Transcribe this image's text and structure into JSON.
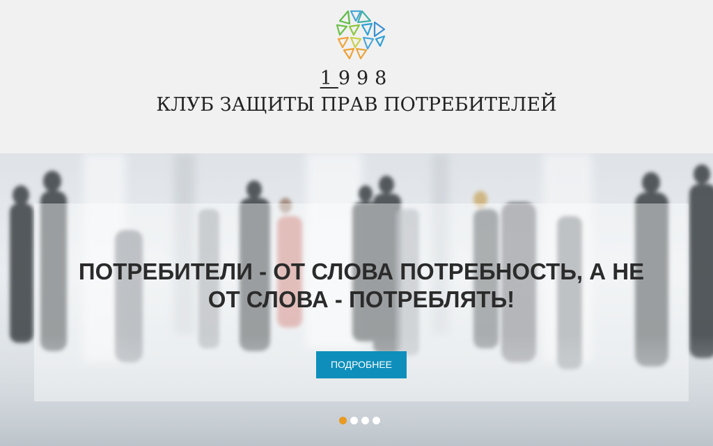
{
  "header": {
    "year_first": "1",
    "year_rest": "998",
    "club_name": "КЛУБ ЗАЩИТЫ ПРАВ ПОТРЕБИТЕЛЕЙ"
  },
  "hero": {
    "slogan_line1": "ПОТРЕБИТЕЛИ - ОТ СЛОВА ПОТРЕБНОСТЬ, А НЕ",
    "slogan_line2": "ОТ СЛОВА - ПОТРЕБЛЯТЬ!",
    "button_label": "ПОДРОБНЕЕ",
    "background_image": "blurred-crowd-image"
  },
  "slider": {
    "total_slides": 4,
    "active_slide": 1
  },
  "colors": {
    "accent": "#0e8fbb",
    "active_dot": "#e89a22",
    "inactive_dot": "#ffffff",
    "background": "#f1f1f1",
    "text": "#222222"
  },
  "icons": {
    "logo": "geometric-triangles-logo"
  }
}
